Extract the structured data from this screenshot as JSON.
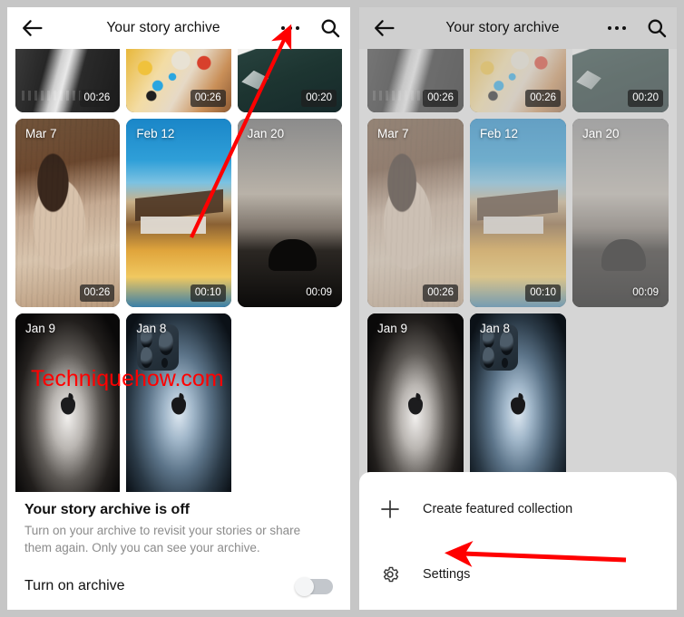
{
  "header": {
    "title": "Your story archive",
    "back_icon": "back-arrow-icon",
    "more_icon": "more-options-icon",
    "search_icon": "search-icon"
  },
  "grid": {
    "row_top": [
      {
        "date": "",
        "duration": "00:26",
        "art": "art-suit",
        "name": "story-tile-suit"
      },
      {
        "date": "",
        "duration": "00:26",
        "art": "art-beads",
        "name": "story-tile-beads"
      },
      {
        "date": "",
        "duration": "00:20",
        "art": "art-teal",
        "name": "story-tile-teal"
      }
    ],
    "row_mid": [
      {
        "date": "Mar 7",
        "duration": "00:26",
        "art": "art-sleep",
        "name": "story-tile-mar-7"
      },
      {
        "date": "Feb 12",
        "duration": "00:10",
        "art": "art-villa",
        "name": "story-tile-feb-12"
      },
      {
        "date": "Jan 20",
        "duration": "00:09",
        "art": "art-lion",
        "name": "story-tile-jan-20"
      }
    ],
    "row_bot": [
      {
        "date": "Jan 9",
        "duration": "",
        "art": "art-phone-dark",
        "name": "story-tile-jan-9"
      },
      {
        "date": "Jan 8",
        "duration": "",
        "art": "art-phone-blue",
        "name": "story-tile-jan-8"
      }
    ]
  },
  "footer": {
    "title": "Your story archive is off",
    "description": "Turn on your archive to revisit your stories or share them again. Only you can see your archive.",
    "toggle_label": "Turn on archive",
    "toggle_state": "off"
  },
  "sheet": {
    "items": [
      {
        "label": "Create featured collection",
        "icon": "plus-icon",
        "name": "menu-item-create-featured-collection"
      },
      {
        "label": "Settings",
        "icon": "gear-icon",
        "name": "menu-item-settings"
      }
    ]
  },
  "watermark": {
    "text": "Techniquehow.com",
    "color": "#ff0000"
  },
  "annotations": {
    "arrow_color": "#ff0000",
    "left_arrow_target": "more-options-icon",
    "right_arrow_target": "menu-item-settings"
  }
}
